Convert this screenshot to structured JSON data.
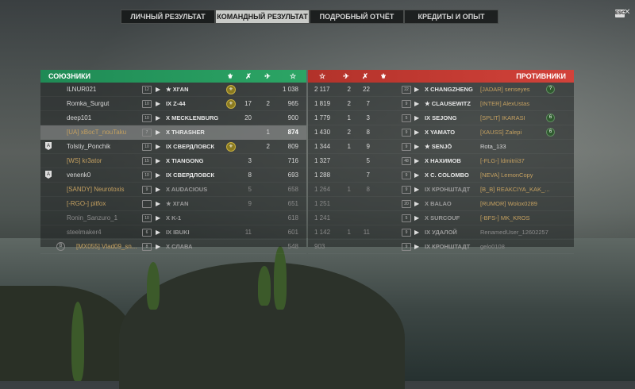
{
  "tabs": [
    "ЛИЧНЫЙ РЕЗУЛЬТАТ",
    "КОМАНДНЫЙ РЕЗУЛЬТАТ",
    "ПОДРОБНЫЙ ОТЧЁТ",
    "КРЕДИТЫ И ОПЫТ"
  ],
  "esc": "ESC",
  "allies": {
    "title": "СОЮЗНИКИ",
    "rows": [
      {
        "name": "ILNUR021",
        "tier": "12",
        "ship": "★ XI'AN",
        "medal": "⚜",
        "kills": "",
        "planes": "",
        "xp": "1 038"
      },
      {
        "name": "Romka_Surgut",
        "tier": "10",
        "ship": "IX Z-44",
        "medal": "⚜",
        "kills": "17",
        "planes": "2",
        "xp": "965"
      },
      {
        "name": "deep101",
        "tier": "10",
        "ship": "X MECKLENBURG",
        "medal": "",
        "kills": "20",
        "planes": "",
        "xp": "900"
      },
      {
        "name": "[UA] xBocT_nouTaku",
        "tier": "7",
        "ship": "X THRASHER",
        "medal": "",
        "kills": "",
        "planes": "1",
        "xp": "874"
      },
      {
        "name": "Tolstiy_Ponchik",
        "tier": "10",
        "ship": "IX СВЕРДЛОВСК",
        "medal": "⚜",
        "kills": "",
        "planes": "2",
        "xp": "809"
      },
      {
        "name": "[WS] kr3ator",
        "tier": "15",
        "ship": "X TIANGONG",
        "medal": "",
        "kills": "3",
        "planes": "",
        "xp": "716"
      },
      {
        "name": "venenk0",
        "tier": "10",
        "ship": "IX СВЕРДЛОВСК",
        "medal": "",
        "kills": "8",
        "planes": "",
        "xp": "693"
      },
      {
        "name": "[SANDY] Neurotoxis",
        "tier": "9",
        "ship": "X AUDACIOUS",
        "medal": "",
        "kills": "5",
        "planes": "",
        "xp": "658"
      },
      {
        "name": "[-RGO-] pitfox",
        "tier": "",
        "ship": "★ XI'AN",
        "medal": "",
        "kills": "9",
        "planes": "",
        "xp": "651"
      },
      {
        "name": "Ronin_Sanzuro_1",
        "tier": "10",
        "ship": "X K-1",
        "medal": "",
        "kills": "",
        "planes": "",
        "xp": "618"
      },
      {
        "name": "steelmaker4",
        "tier": "6",
        "ship": "IX IBUKI",
        "medal": "",
        "kills": "11",
        "planes": "",
        "xp": "601"
      },
      {
        "name": "[MX055] Vlad09_sn...",
        "tier": "8",
        "ship": "X СЛАВА",
        "medal": "",
        "kills": "",
        "planes": "",
        "xp": "548"
      }
    ]
  },
  "enemies": {
    "title": "ПРОТИВНИКИ",
    "rows": [
      {
        "xp": "2 117",
        "planes": "2",
        "kills": "22",
        "tier": "22",
        "ship": "X CHANGZHENG",
        "name": "[JADAR] senseyes"
      },
      {
        "xp": "1 819",
        "planes": "2",
        "kills": "7",
        "tier": "9",
        "ship": "★ CLAUSEWITZ",
        "name": "[INTER] AlexUstas"
      },
      {
        "xp": "1 779",
        "planes": "1",
        "kills": "3",
        "tier": "5",
        "ship": "IX SEJONG",
        "name": "[SPLIT] IKARASI"
      },
      {
        "xp": "1 430",
        "planes": "2",
        "kills": "8",
        "tier": "9",
        "ship": "X YAMATO",
        "name": "[XAUSS] Zalepi"
      },
      {
        "xp": "1 344",
        "planes": "1",
        "kills": "9",
        "tier": "9",
        "ship": "★ SENJŌ",
        "name": "Rota_133"
      },
      {
        "xp": "1 327",
        "planes": "",
        "kills": "5",
        "tier": "48",
        "ship": "X НАХИМОВ",
        "name": "[-FLG-] ldmitrii37"
      },
      {
        "xp": "1 288",
        "planes": "",
        "kills": "7",
        "tier": "9",
        "ship": "X C. COLOMBO",
        "name": "[NEVA] LemonCopy"
      },
      {
        "xp": "1 264",
        "planes": "1",
        "kills": "8",
        "tier": "9",
        "ship": "IX КРОНШТАДТ",
        "name": "[B_B] REAKCIYA_KAK_..."
      },
      {
        "xp": "1 251",
        "planes": "",
        "kills": "",
        "tier": "20",
        "ship": "X BALAO",
        "name": "[RUMOR] Wolox0289"
      },
      {
        "xp": "1 241",
        "planes": "",
        "kills": "",
        "tier": "5",
        "ship": "X SURCOUF",
        "name": "[-BFS-] MK_KROS"
      },
      {
        "xp": "1 142",
        "planes": "1",
        "kills": "11",
        "tier": "9",
        "ship": "IX УДАЛОЙ",
        "name": "RenamedUser_12602257"
      },
      {
        "xp": "903",
        "planes": "",
        "kills": "",
        "tier": "9",
        "ship": "IX КРОНШТАДТ",
        "name": "gelo0108"
      }
    ]
  }
}
